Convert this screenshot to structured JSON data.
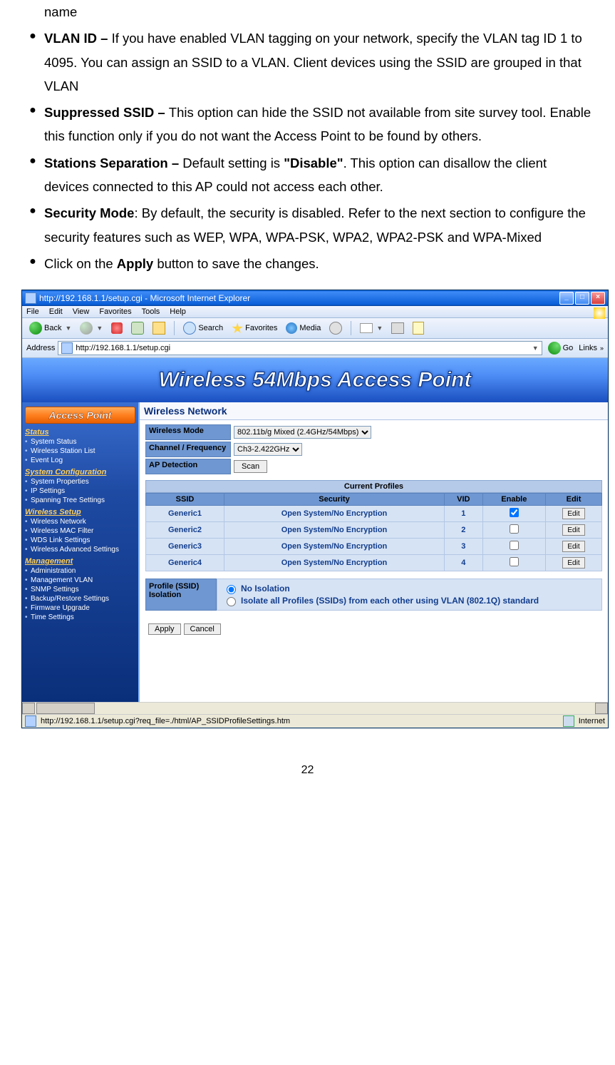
{
  "bullets": {
    "b0": "name",
    "b1_bold": "VLAN ID – ",
    "b1_rest": "If you have enabled VLAN tagging on your network, specify the VLAN tag ID 1 to 4095. You can assign an SSID to a VLAN. Client devices using the SSID are grouped in that VLAN",
    "b2_bold": "Suppressed SSID – ",
    "b2_rest": "This option can hide the SSID not available from site survey tool. Enable this function only if you do not want the Access Point to be found by others.",
    "b3_bold": "Stations Separation – ",
    "b3_mid1": "Default setting is ",
    "b3_bold2": "\"Disable\"",
    "b3_rest": ". This option can disallow the client devices connected to this AP could not access each other.",
    "b4_bold": "Security Mode",
    "b4_rest": ": By default, the security is disabled. Refer to the next section to configure the security features such as WEP, WPA, WPA-PSK, WPA2, WPA2-PSK and WPA-Mixed",
    "b5_pre": "Click on the ",
    "b5_bold": "Apply",
    "b5_rest": " button to save the changes."
  },
  "browser": {
    "title": "http://192.168.1.1/setup.cgi - Microsoft Internet Explorer",
    "menu": [
      "File",
      "Edit",
      "View",
      "Favorites",
      "Tools",
      "Help"
    ],
    "tb": {
      "back": "Back",
      "search": "Search",
      "favorites": "Favorites",
      "media": "Media"
    },
    "address_label": "Address",
    "url": "http://192.168.1.1/setup.cgi",
    "go": "Go",
    "links": "Links",
    "status_url": "http://192.168.1.1/setup.cgi?req_file=./html/AP_SSIDProfileSettings.htm",
    "status_zone": "Internet"
  },
  "banner": "Wireless 54Mbps Access Point",
  "sidebar": {
    "title": "Access Point",
    "groups": [
      {
        "head": "Status",
        "items": [
          "System Status",
          "Wireless Station List",
          "Event Log"
        ]
      },
      {
        "head": "System Configuration",
        "items": [
          "System Properties",
          "IP Settings",
          "Spanning Tree Settings"
        ]
      },
      {
        "head": "Wireless Setup",
        "items": [
          "Wireless Network",
          "Wireless MAC Filter",
          "WDS Link Settings",
          "Wireless Advanced Settings"
        ]
      },
      {
        "head": "Management",
        "items": [
          "Administration",
          "Management VLAN",
          "SNMP Settings",
          "Backup/Restore Settings",
          "Firmware Upgrade",
          "Time Settings"
        ]
      }
    ]
  },
  "wn": {
    "section": "Wireless Network",
    "mode_label": "Wireless Mode",
    "mode_val": "802.11b/g Mixed (2.4GHz/54Mbps)",
    "chan_label": "Channel / Frequency",
    "chan_val": "Ch3-2.422GHz",
    "apdet_label": "AP Detection",
    "scan": "Scan",
    "profiles_title": "Current Profiles",
    "th": {
      "ssid": "SSID",
      "sec": "Security",
      "vid": "VID",
      "en": "Enable",
      "edit": "Edit"
    },
    "rows": [
      {
        "ssid": "Generic1",
        "sec": "Open System/No Encryption",
        "vid": "1",
        "en": true
      },
      {
        "ssid": "Generic2",
        "sec": "Open System/No Encryption",
        "vid": "2",
        "en": false
      },
      {
        "ssid": "Generic3",
        "sec": "Open System/No Encryption",
        "vid": "3",
        "en": false
      },
      {
        "ssid": "Generic4",
        "sec": "Open System/No Encryption",
        "vid": "4",
        "en": false
      }
    ],
    "edit_btn": "Edit",
    "iso_label": "Profile (SSID) Isolation",
    "iso_no": "No Isolation",
    "iso_yes": "Isolate all Profiles (SSIDs) from each other using VLAN (802.1Q) standard",
    "apply": "Apply",
    "cancel": "Cancel"
  },
  "page_number": "22"
}
